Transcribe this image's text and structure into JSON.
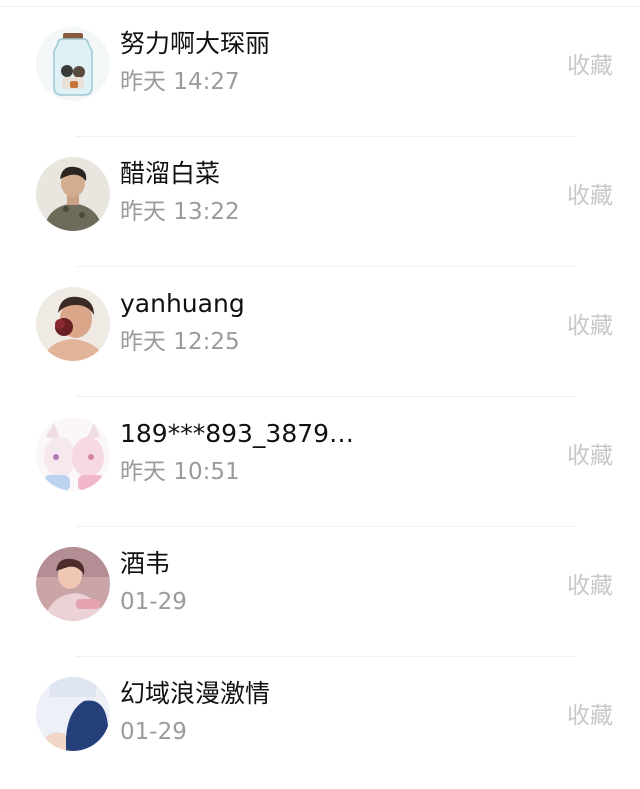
{
  "contacts": [
    {
      "name": "努力啊大琛丽",
      "time": "昨天 14:27",
      "action": "收藏"
    },
    {
      "name": "醋溜白菜",
      "time": "昨天 13:22",
      "action": "收藏"
    },
    {
      "name": "yanhuang",
      "time": "昨天 12:25",
      "action": "收藏"
    },
    {
      "name": "189***893_3879…",
      "time": "昨天 10:51",
      "action": "收藏"
    },
    {
      "name": "酒韦",
      "time": "01-29",
      "action": "收藏"
    },
    {
      "name": "幻域浪漫激情",
      "time": "01-29",
      "action": "收藏"
    }
  ]
}
